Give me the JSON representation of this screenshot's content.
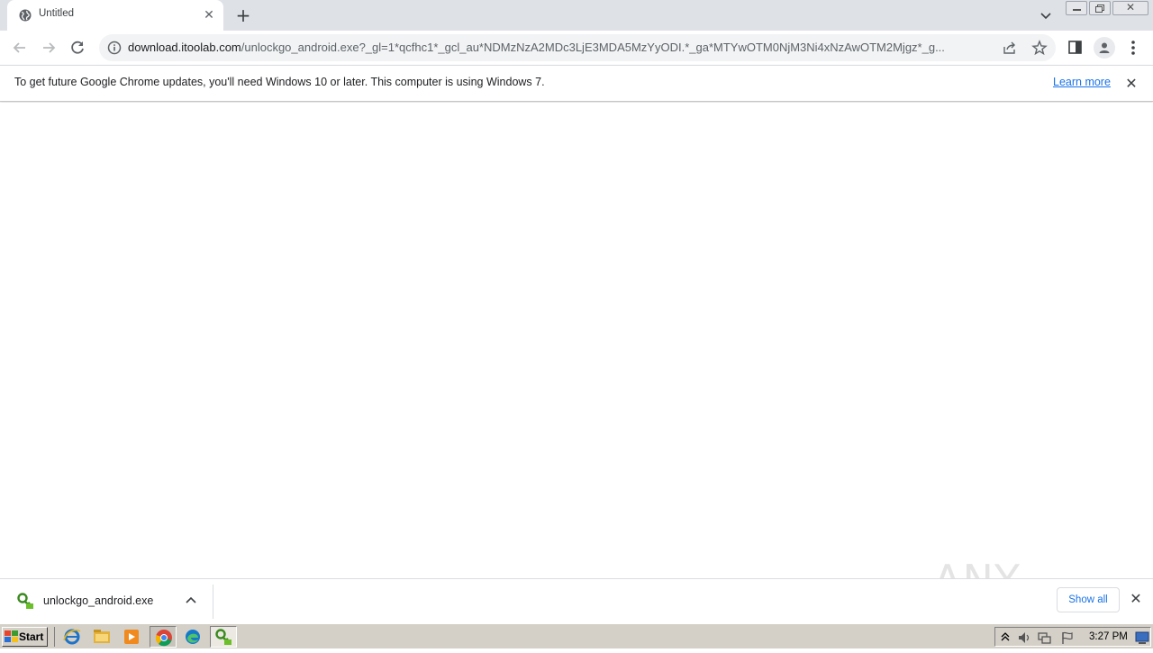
{
  "tab": {
    "title": "Untitled",
    "favicon": "globe-icon"
  },
  "toolbar": {
    "url_host": "download.itoolab.com",
    "url_path": "/unlockgo_android.exe?_gl=1*qcfhc1*_gcl_au*NDMzNzA2MDc3LjE3MDA5MzYyODI.*_ga*MTYwOTM0NjM3Ni4xNzAwOTM2Mjgz*_g..."
  },
  "infobar": {
    "message": "To get future Google Chrome updates, you'll need Windows 10 or later. This computer is using Windows 7.",
    "learn_more": "Learn more"
  },
  "downloads": {
    "items": [
      {
        "filename": "unlockgo_android.exe"
      }
    ],
    "show_all": "Show all"
  },
  "watermark": {
    "text": "ANY RUN"
  },
  "taskbar": {
    "start_label": "Start",
    "clock": "3:27 PM"
  },
  "colors": {
    "link": "#1a73e8",
    "tabstrip": "#dee1e6",
    "taskbar": "#d4d0c8"
  }
}
